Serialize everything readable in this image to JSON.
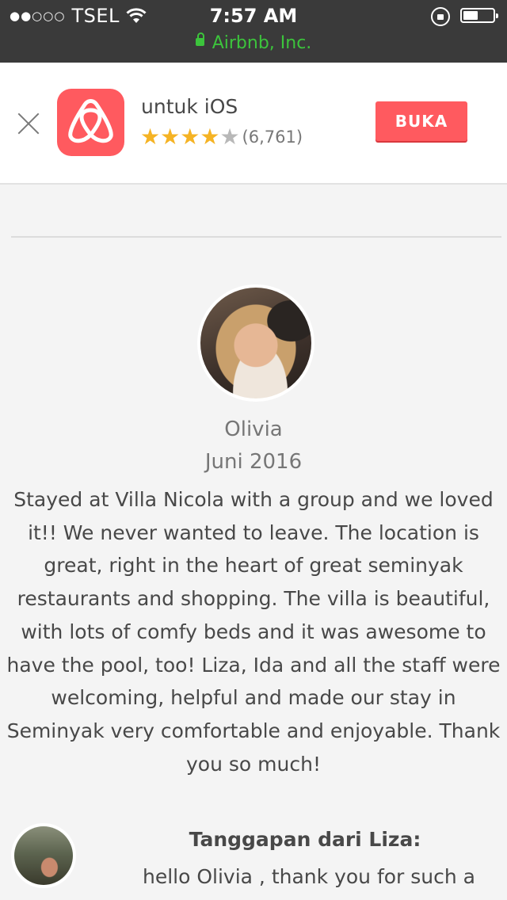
{
  "status_bar": {
    "carrier": "TSEL",
    "signal_dots": "●●○○○",
    "time": "7:57 AM",
    "site": "Airbnb, Inc."
  },
  "app_banner": {
    "app_name": "untuk iOS",
    "rating_stars": 4,
    "rating_max": 5,
    "rating_count": "(6,761)",
    "open_label": "BUKA",
    "brand_color": "#ff5a5f"
  },
  "review": {
    "reviewer_name": "Olivia",
    "date": "Juni 2016",
    "text": "Stayed at Villa Nicola with a group and we loved it!! We never wanted to leave. The location is great, right in the heart of great seminyak restaurants and shopping. The villa is beautiful, with lots of comfy beds and it was awesome to have the pool, too! Liza, Ida and all the staff were welcoming, helpful and made our stay in Seminyak very comfortable and enjoyable. Thank you so much!"
  },
  "host_response": {
    "title": "Tanggapan dari Liza:",
    "text": "hello Olivia , thank you for such a"
  }
}
